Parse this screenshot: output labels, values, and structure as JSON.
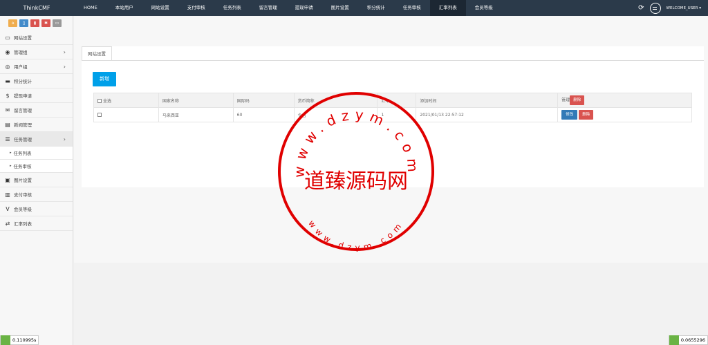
{
  "brand": "ThinkCMF",
  "nav": [
    "HOME",
    "本站用户",
    "网站设置",
    "支付审核",
    "任务列表",
    "留言管理",
    "提现申请",
    "图片设置",
    "积分统计",
    "任务审核",
    "汇率列表",
    "会员等级"
  ],
  "nav_active": 10,
  "user": {
    "welcome": "WELCOME_USER ▾"
  },
  "sidebar": {
    "shortcut_colors": [
      "#f0ad4e",
      "#428bca",
      "#d9534f",
      "#d9534f",
      "#999999"
    ],
    "items": [
      {
        "label": "网站设置",
        "icon": "monitor-icon",
        "glyph": "▭",
        "arrow": false
      },
      {
        "label": "管理组",
        "icon": "user-circle-icon",
        "glyph": "◉",
        "arrow": true
      },
      {
        "label": "用户组",
        "icon": "user-icon",
        "glyph": "◎",
        "arrow": true
      },
      {
        "label": "积分统计",
        "icon": "visa-icon",
        "glyph": "▬",
        "arrow": false
      },
      {
        "label": "提现申请",
        "icon": "dollar-icon",
        "glyph": "$",
        "arrow": false
      },
      {
        "label": "留言管理",
        "icon": "envelope-icon",
        "glyph": "✉",
        "arrow": false
      },
      {
        "label": "新闻管理",
        "icon": "newspaper-icon",
        "glyph": "▤",
        "arrow": false
      },
      {
        "label": "任务管理",
        "icon": "tasks-icon",
        "glyph": "☰",
        "arrow": true,
        "active": true
      }
    ],
    "sub_items": [
      {
        "label": "任务列表"
      },
      {
        "label": "任务审核"
      }
    ],
    "items_after": [
      {
        "label": "图片设置",
        "icon": "image-icon",
        "glyph": "▣"
      },
      {
        "label": "支付审核",
        "icon": "id-card-icon",
        "glyph": "▥"
      },
      {
        "label": "会员等级",
        "icon": "vine-icon",
        "glyph": "V"
      },
      {
        "label": "汇率列表",
        "icon": "exchange-icon",
        "glyph": "⇄"
      }
    ]
  },
  "main": {
    "tab": "网站设置",
    "new_button": "新增",
    "table": {
      "headers": {
        "select_all": "全选",
        "country": "国家名称",
        "code": "国际码",
        "currency": "货币简称",
        "rate": "汇率",
        "added": "添加时间",
        "manage": "管理"
      },
      "header_delete": "删除",
      "rows": [
        {
          "country": "马来西亚",
          "code": "60",
          "currency": "令吉",
          "rate": "1",
          "added": "2021/01/13 22:57:12",
          "edit": "修改",
          "delete": "删除"
        }
      ]
    }
  },
  "watermark": {
    "top": "www.dzym.com",
    "center": "道臻源码网",
    "bottom": "www.dzym.com"
  },
  "debug": {
    "left": "0.110995s",
    "right": "0.0655296"
  }
}
